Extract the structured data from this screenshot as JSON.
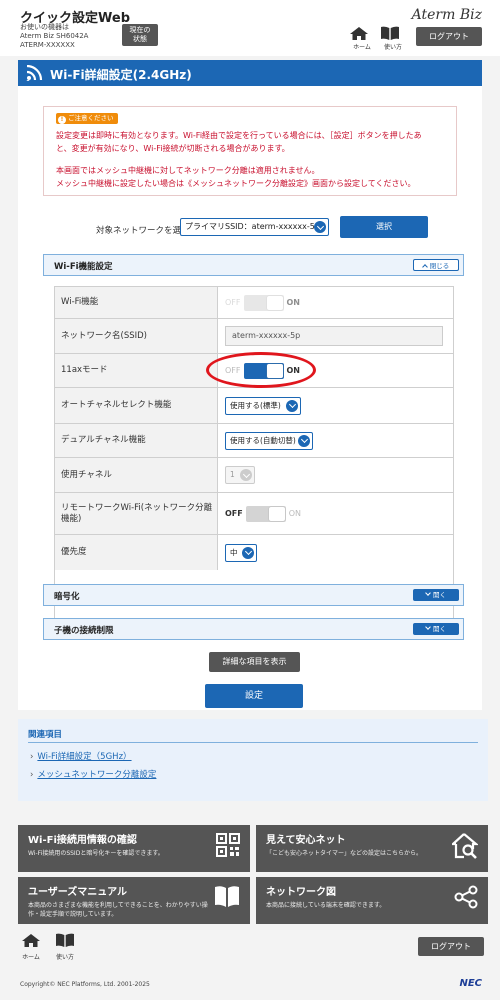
{
  "header": {
    "app_title": "クイック設定Web",
    "device_line1": "お使いの機器は",
    "device_line2": "Aterm Biz SH6042A",
    "device_line3": "ATERM-XXXXXX",
    "status_btn_line1": "現在の",
    "status_btn_line2": "状態",
    "brand": "Aterm Biz",
    "home_label": "ホーム",
    "manual_label": "使い方",
    "logout": "ログアウト"
  },
  "page": {
    "title": "Wi-Fi詳細設定(2.4GHz)",
    "caution_badge": "ご注意ください",
    "notice_line1": "設定変更は即時に有効となります。Wi-Fi経由で設定を行っている場合には、［設定］ボタンを押したあ",
    "notice_line2": "と、変更が有効になり、Wi-Fi接続が切断される場合があります。",
    "notice_line3": "本画面ではメッシュ中継機に対してネットワーク分離は適用されません。",
    "notice_line4": "メッシュ中継機に設定したい場合は《メッシュネットワーク分離設定》画面から設定してください。",
    "target_label": "対象ネットワークを選択",
    "target_value": "プライマリSSID：aterm-xxxxxx-5p",
    "select_btn": "選択"
  },
  "wifi_section": {
    "title": "Wi-Fi機能設定",
    "close_btn": "閉じる",
    "rows": [
      {
        "label": "Wi-Fi機能",
        "off": "OFF",
        "on": "ON",
        "state": "off"
      },
      {
        "label": "ネットワーク名(SSID)",
        "value": "aterm-xxxxxx-5p"
      },
      {
        "label": "11axモード",
        "off": "OFF",
        "on": "ON",
        "state": "on"
      },
      {
        "label": "オートチャネルセレクト機能",
        "value": "使用する(標準)"
      },
      {
        "label": "デュアルチャネル機能",
        "value": "使用する(自動切替)"
      },
      {
        "label": "使用チャネル",
        "value": "1"
      },
      {
        "label": "リモートワークWi-Fi(ネットワーク分離機能)",
        "off": "OFF",
        "on": "ON",
        "state": "off"
      },
      {
        "label": "優先度",
        "value": "中"
      }
    ]
  },
  "encryption_section": {
    "title": "暗号化",
    "open_btn": "開く"
  },
  "child_section": {
    "title": "子機の接続制限",
    "open_btn": "開く"
  },
  "buttons": {
    "details": "詳細な項目を表示",
    "save": "設定"
  },
  "related": {
    "heading": "関連項目",
    "links": [
      "Wi-Fi詳細設定（5GHz）",
      "メッシュネットワーク分離設定"
    ]
  },
  "tiles": [
    {
      "title": "Wi-Fi接続用情報の確認",
      "desc": "Wi-Fi接続用のSSIDと暗号化キーを確認できます。",
      "icon": "qr-code-icon"
    },
    {
      "title": "見えて安心ネット",
      "desc": "「こども安心ネットタイマー」などの設定はこちらから。",
      "icon": "home-search-icon"
    },
    {
      "title": "ユーザーズマニュアル",
      "desc": "本商品のさまざまな機能を利用してできることを、わかりやすい操作・設定手順で説明しています。",
      "icon": "book-icon"
    },
    {
      "title": "ネットワーク図",
      "desc": "本商品に接続している端末を確認できます。",
      "icon": "share-network-icon"
    }
  ],
  "footer": {
    "home_label": "ホーム",
    "manual_label": "使い方",
    "logout": "ログアウト",
    "copyright": "Copyright© NEC Platforms, Ltd. 2001-2025",
    "nec": "NEC"
  },
  "colors": {
    "primary": "#1c67b4",
    "dark_button": "#555555",
    "caution": "#f08c0a",
    "notice_text": "#c8102e",
    "highlight_ring": "#e0161d"
  }
}
